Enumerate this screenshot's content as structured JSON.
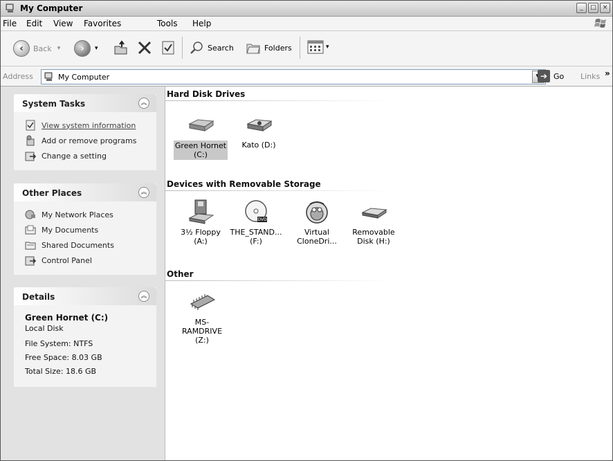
{
  "window": {
    "title": "My Computer",
    "controls": [
      "_",
      "□",
      "×"
    ]
  },
  "menubar": [
    "File",
    "Edit",
    "View",
    "Favorites",
    "Tools",
    "Help"
  ],
  "toolbar": {
    "back_label": "Back",
    "search_label": "Search",
    "folders_label": "Folders"
  },
  "address": {
    "label": "Address",
    "value": "My Computer",
    "go_label": "Go",
    "links_label": "Links"
  },
  "sidebar": {
    "system_tasks": {
      "title": "System Tasks",
      "items": [
        "View system information",
        "Add or remove programs",
        "Change a setting"
      ]
    },
    "other_places": {
      "title": "Other Places",
      "items": [
        "My Network Places",
        "My Documents",
        "Shared Documents",
        "Control Panel"
      ]
    },
    "details": {
      "title": "Details",
      "name": "Green Hornet (C:)",
      "type": "Local Disk",
      "filesystem": "File System: NTFS",
      "free_space": "Free Space: 8.03 GB",
      "total_size": "Total Size: 18.6 GB"
    }
  },
  "content": {
    "groups": [
      {
        "title": "Hard Disk Drives",
        "items": [
          {
            "line1": "Green Hornet",
            "line2": "(C:)",
            "icon": "hard-drive-icon"
          },
          {
            "line1": "Kato (D:)",
            "line2": "",
            "icon": "hard-drive-icon"
          }
        ]
      },
      {
        "title": "Devices with Removable Storage",
        "items": [
          {
            "line1": "3½ Floppy",
            "line2": "(A:)",
            "icon": "floppy-drive-icon"
          },
          {
            "line1": "THE_STAND...",
            "line2": "(F:)",
            "icon": "dvd-drive-icon"
          },
          {
            "line1": "Virtual",
            "line2": "CloneDri...",
            "icon": "clonedrive-icon"
          },
          {
            "line1": "Removable",
            "line2": "Disk (H:)",
            "icon": "removable-disk-icon"
          }
        ]
      },
      {
        "title": "Other",
        "items": [
          {
            "line1": "MS-RAMDRIVE",
            "line2": "(Z:)",
            "icon": "ram-drive-icon"
          }
        ]
      }
    ]
  }
}
